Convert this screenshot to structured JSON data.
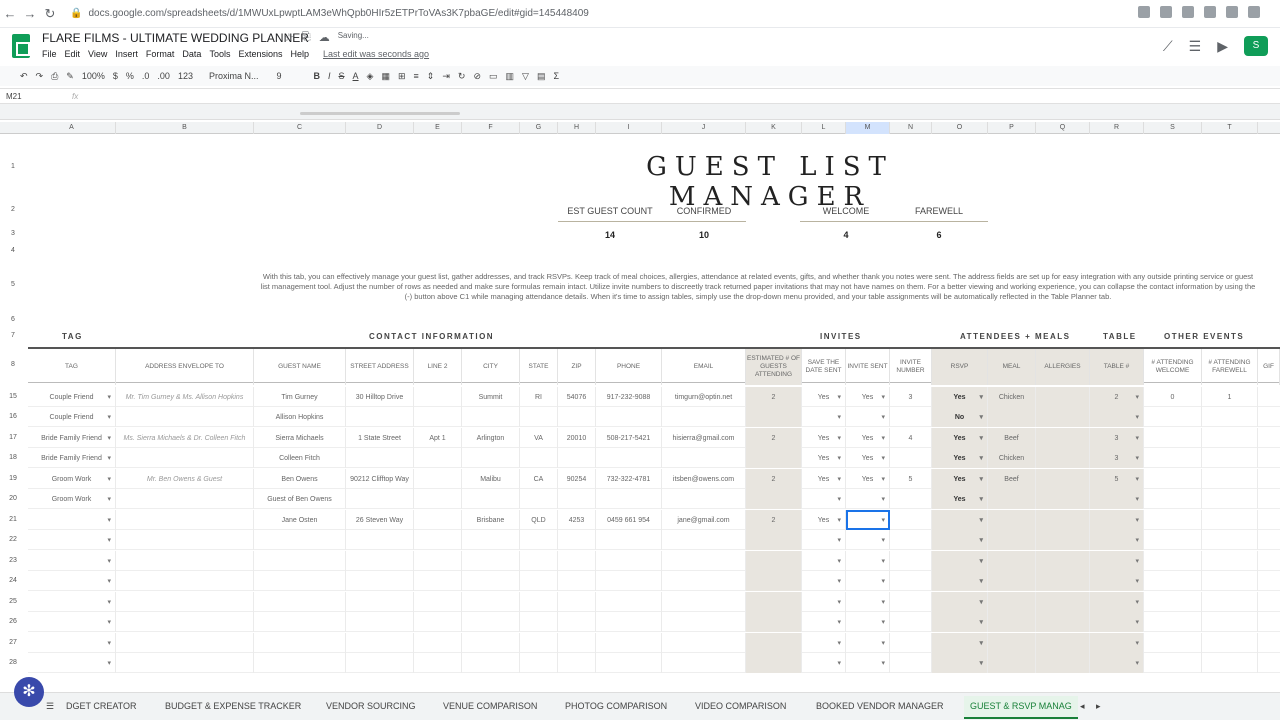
{
  "browser": {
    "url": "docs.google.com/spreadsheets/d/1MWUxLpwptLAM3eWhQpb0HIr5zETPrToVAs3K7pbaGE/edit#gid=145448409"
  },
  "doc": {
    "title": "FLARE FILMS - ULTIMATE WEDDING PLANNER",
    "saving": "Saving...",
    "last_edit": "Last edit was seconds ago"
  },
  "menus": [
    "File",
    "Edit",
    "View",
    "Insert",
    "Format",
    "Data",
    "Tools",
    "Extensions",
    "Help"
  ],
  "toolbar": {
    "zoom": "100%",
    "font": "Proxima N...",
    "size": "9",
    "format": "123"
  },
  "namebox": "M21",
  "sheet": {
    "title": "GUEST LIST MANAGER",
    "stats": [
      {
        "label": "EST GUEST COUNT",
        "value": "14"
      },
      {
        "label": "CONFIRMED",
        "value": "10"
      },
      {
        "label": "WELCOME",
        "value": "4"
      },
      {
        "label": "FAREWELL",
        "value": "6"
      }
    ],
    "description": "With this tab, you can effectively manage your guest list, gather addresses, and track RSVPs. Keep track of meal choices, allergies, attendance at related events, gifts, and whether thank you notes were sent. The address fields are set up for easy integration with any outside printing service or guest list management tool. Adjust the number of rows as needed and make sure formulas remain intact. Utilize invite numbers to discreetly track returned paper invitations that may not have names on them. For a better viewing and working experience, you can collapse the contact information by using the (-) button above C1 while managing attendance details. When it's time to assign tables, simply use the drop-down menu provided, and your table assignments will be automatically reflected in the Table Planner tab.",
    "sections": [
      "TAG",
      "CONTACT INFORMATION",
      "INVITES",
      "ATTENDEES + MEALS",
      "TABLE",
      "OTHER EVENTS"
    ],
    "columns": [
      "A",
      "B",
      "C",
      "D",
      "E",
      "F",
      "G",
      "H",
      "I",
      "J",
      "K",
      "L",
      "M",
      "N",
      "O",
      "P",
      "Q",
      "R",
      "S",
      "T"
    ],
    "headers": [
      "TAG",
      "ADDRESS ENVELOPE TO",
      "GUEST NAME",
      "STREET ADDRESS",
      "LINE 2",
      "CITY",
      "STATE",
      "ZIP",
      "PHONE",
      "EMAIL",
      "ESTIMATED # OF GUESTS ATTENDING",
      "SAVE THE DATE SENT",
      "INVITE SENT",
      "INVITE NUMBER",
      "RSVP",
      "MEAL",
      "ALLERGIES",
      "TABLE #",
      "# ATTENDING WELCOME",
      "# ATTENDING FAREWELL",
      "GIF"
    ],
    "rows": [
      {
        "num": "15",
        "tag": "Couple Friend",
        "env": "Mr. Tim Gurney & Ms. Allison Hopkins",
        "guest": "Tim Gurney",
        "street": "30 Hilltop Drive",
        "line2": "",
        "city": "Summit",
        "state": "RI",
        "zip": "54076",
        "phone": "917-232-9088",
        "email": "timgurn@optin.net",
        "est": "2",
        "std": "Yes",
        "inv": "Yes",
        "invnum": "3",
        "rsvp": "Yes",
        "meal": "Chicken",
        "allergies": "",
        "table": "2",
        "welcome": "0",
        "farewell": "1"
      },
      {
        "num": "16",
        "tag": "Couple Friend",
        "env": "",
        "guest": "Allison Hopkins",
        "street": "",
        "line2": "",
        "city": "",
        "state": "",
        "zip": "",
        "phone": "",
        "email": "",
        "est": "",
        "std": "",
        "inv": "",
        "invnum": "",
        "rsvp": "No",
        "meal": "",
        "allergies": "",
        "table": "",
        "welcome": "",
        "farewell": ""
      },
      {
        "num": "17",
        "tag": "Bride Family Friend",
        "env": "Ms. Sierra Michaels & Dr. Colleen Fitch",
        "guest": "Sierra Michaels",
        "street": "1 State Street",
        "line2": "Apt 1",
        "city": "Arlington",
        "state": "VA",
        "zip": "20010",
        "phone": "508-217-5421",
        "email": "hisierra@gmail.com",
        "est": "2",
        "std": "Yes",
        "inv": "Yes",
        "invnum": "4",
        "rsvp": "Yes",
        "meal": "Beef",
        "allergies": "",
        "table": "3",
        "welcome": "",
        "farewell": ""
      },
      {
        "num": "18",
        "tag": "Bride Family Friend",
        "env": "",
        "guest": "Colleen Fitch",
        "street": "",
        "line2": "",
        "city": "",
        "state": "",
        "zip": "",
        "phone": "",
        "email": "",
        "est": "",
        "std": "Yes",
        "inv": "Yes",
        "invnum": "",
        "rsvp": "Yes",
        "meal": "Chicken",
        "allergies": "",
        "table": "3",
        "welcome": "",
        "farewell": ""
      },
      {
        "num": "19",
        "tag": "Groom Work",
        "env": "Mr. Ben Owens & Guest",
        "guest": "Ben Owens",
        "street": "90212 Clifftop Way",
        "line2": "",
        "city": "Malibu",
        "state": "CA",
        "zip": "90254",
        "phone": "732-322-4781",
        "email": "itsben@owens.com",
        "est": "2",
        "std": "Yes",
        "inv": "Yes",
        "invnum": "5",
        "rsvp": "Yes",
        "meal": "Beef",
        "allergies": "",
        "table": "5",
        "welcome": "",
        "farewell": ""
      },
      {
        "num": "20",
        "tag": "Groom Work",
        "env": "",
        "guest": "Guest of Ben Owens",
        "street": "",
        "line2": "",
        "city": "",
        "state": "",
        "zip": "",
        "phone": "",
        "email": "",
        "est": "",
        "std": "",
        "inv": "",
        "invnum": "",
        "rsvp": "Yes",
        "meal": "",
        "allergies": "",
        "table": "",
        "welcome": "",
        "farewell": ""
      },
      {
        "num": "21",
        "tag": "",
        "env": "",
        "guest": "Jane Osten",
        "street": "26 Steven Way",
        "line2": "",
        "city": "Brisbane",
        "state": "QLD",
        "zip": "4253",
        "phone": "0459 661 954",
        "email": "jane@gmail.com",
        "est": "2",
        "std": "Yes",
        "inv": "",
        "invnum": "",
        "rsvp": "",
        "meal": "",
        "allergies": "",
        "table": "",
        "welcome": "",
        "farewell": ""
      },
      {
        "num": "22"
      },
      {
        "num": "23"
      },
      {
        "num": "24"
      },
      {
        "num": "25"
      },
      {
        "num": "26"
      },
      {
        "num": "27"
      },
      {
        "num": "28"
      }
    ]
  },
  "tabs": [
    "DGET CREATOR",
    "BUDGET & EXPENSE TRACKER",
    "VENDOR SOURCING",
    "VENUE COMPARISON",
    "PHOTOG COMPARISON",
    "VIDEO COMPARISON",
    "BOOKED VENDOR MANAGER",
    "GUEST & RSVP MANAG"
  ]
}
